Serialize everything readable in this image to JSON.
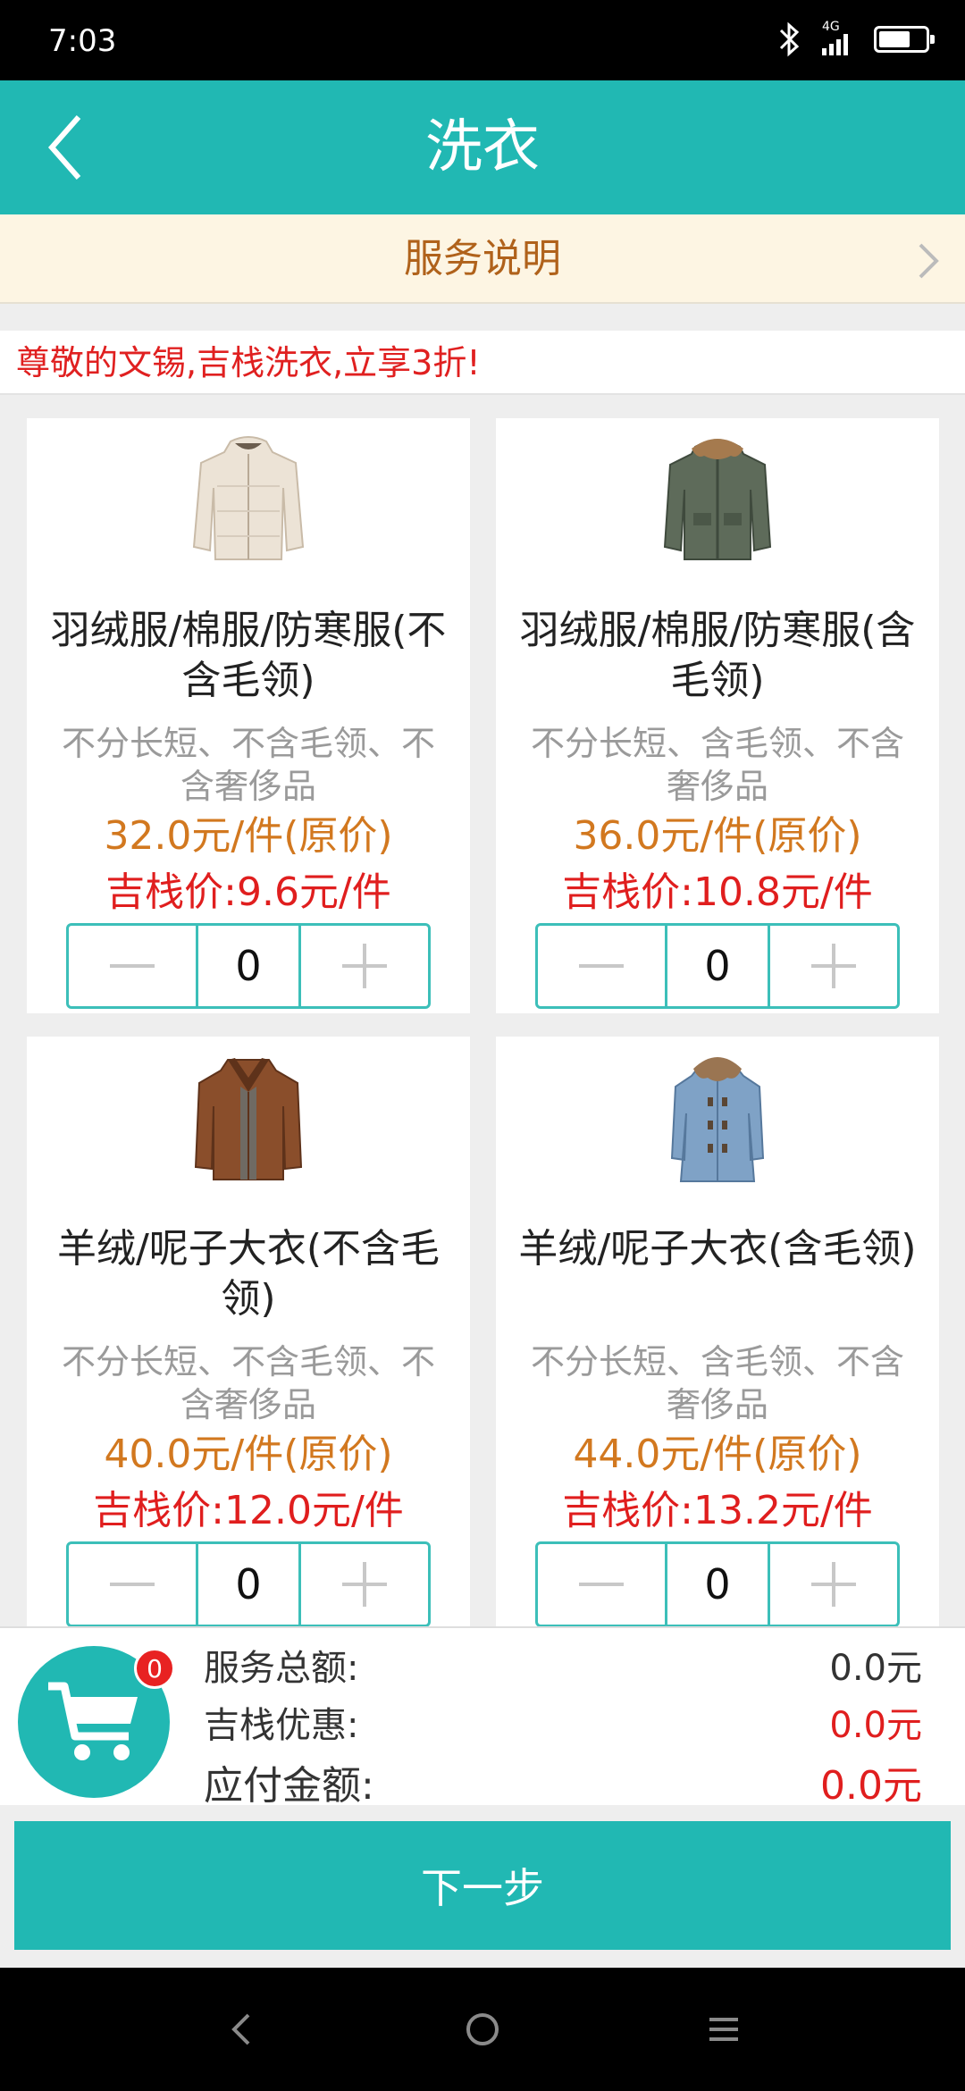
{
  "status_bar": {
    "time": "7:03",
    "network": "4G"
  },
  "header": {
    "title": "洗衣"
  },
  "service_bar": {
    "label": "服务说明"
  },
  "promo": {
    "text": "尊敬的文锡,吉栈洗衣,立享3折!"
  },
  "products": [
    {
      "name": "羽绒服/棉服/防寒服(不含毛领)",
      "desc": "不分长短、不含毛领、不含奢侈品",
      "original_price": "32.0元/件(原价)",
      "jz_price": "吉栈价:9.6元/件",
      "quantity": "0",
      "image_icon": "down-jacket-cream-icon"
    },
    {
      "name": "羽绒服/棉服/防寒服(含毛领)",
      "desc": "不分长短、含毛领、不含奢侈品",
      "original_price": "36.0元/件(原价)",
      "jz_price": "吉栈价:10.8元/件",
      "quantity": "0",
      "image_icon": "parka-green-fur-icon"
    },
    {
      "name": "羊绒/呢子大衣(不含毛领)",
      "desc": "不分长短、不含毛领、不含奢侈品",
      "original_price": "40.0元/件(原价)",
      "jz_price": "吉栈价:12.0元/件",
      "quantity": "0",
      "image_icon": "wool-coat-brown-icon"
    },
    {
      "name": "羊绒/呢子大衣(含毛领)",
      "desc": "不分长短、含毛领、不含奢侈品",
      "original_price": "44.0元/件(原价)",
      "jz_price": "吉栈价:13.2元/件",
      "quantity": "0",
      "image_icon": "wool-coat-blue-fur-icon"
    }
  ],
  "summary": {
    "cart_count": "0",
    "total_label": "服务总额:",
    "total_value": "0.0元",
    "discount_label": "吉栈优惠:",
    "discount_value": "0.0元",
    "payable_label": "应付金额:",
    "payable_value": "0.0元"
  },
  "next_button": {
    "label": "下一步"
  },
  "colors": {
    "accent": "#21b8b3",
    "orange": "#d2781f",
    "red": "#e01e1e",
    "service_bg": "#fdf5e3"
  }
}
